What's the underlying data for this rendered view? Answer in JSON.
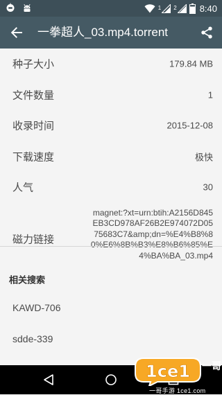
{
  "status_bar": {
    "time": "8:40",
    "sim1": "1",
    "sim2": "2",
    "left_icons": [
      "notification-icon",
      "android-icon"
    ],
    "right_icons": [
      "wifi-icon",
      "signal-icon",
      "signal-icon",
      "battery-icon"
    ]
  },
  "app_bar": {
    "title": "一拳超人_03.mp4.torrent",
    "back_icon": "arrow-back-icon",
    "share_icon": "share-icon"
  },
  "details": [
    {
      "label": "种子大小",
      "value": "179.84 MB"
    },
    {
      "label": "文件数量",
      "value": "1"
    },
    {
      "label": "收录时间",
      "value": "2015-12-08"
    },
    {
      "label": "下载速度",
      "value": "极快"
    },
    {
      "label": "人气",
      "value": "30"
    }
  ],
  "magnet": {
    "label": "磁力链接",
    "value": "magnet:?xt=urn:btih:A2156D845EB3CD978AF26B2E974072D0575683C7&amp;dn=%E4%B8%80%E6%8B%B3%E8%B6%85%E4%BA%BA_03.mp4"
  },
  "related": {
    "header": "相关搜索",
    "items": [
      "KAWD-706",
      "sdde-339"
    ]
  },
  "watermark": {
    "text": "1ce1",
    "brand": "一哥",
    "url": "一哥手游 1ce1.com"
  },
  "colors": {
    "status_bar": "#3d4f58",
    "app_bar": "#455a64",
    "background": "#f4f4f4",
    "nav_bar": "#000000",
    "watermark_orange": "#f7a825"
  }
}
